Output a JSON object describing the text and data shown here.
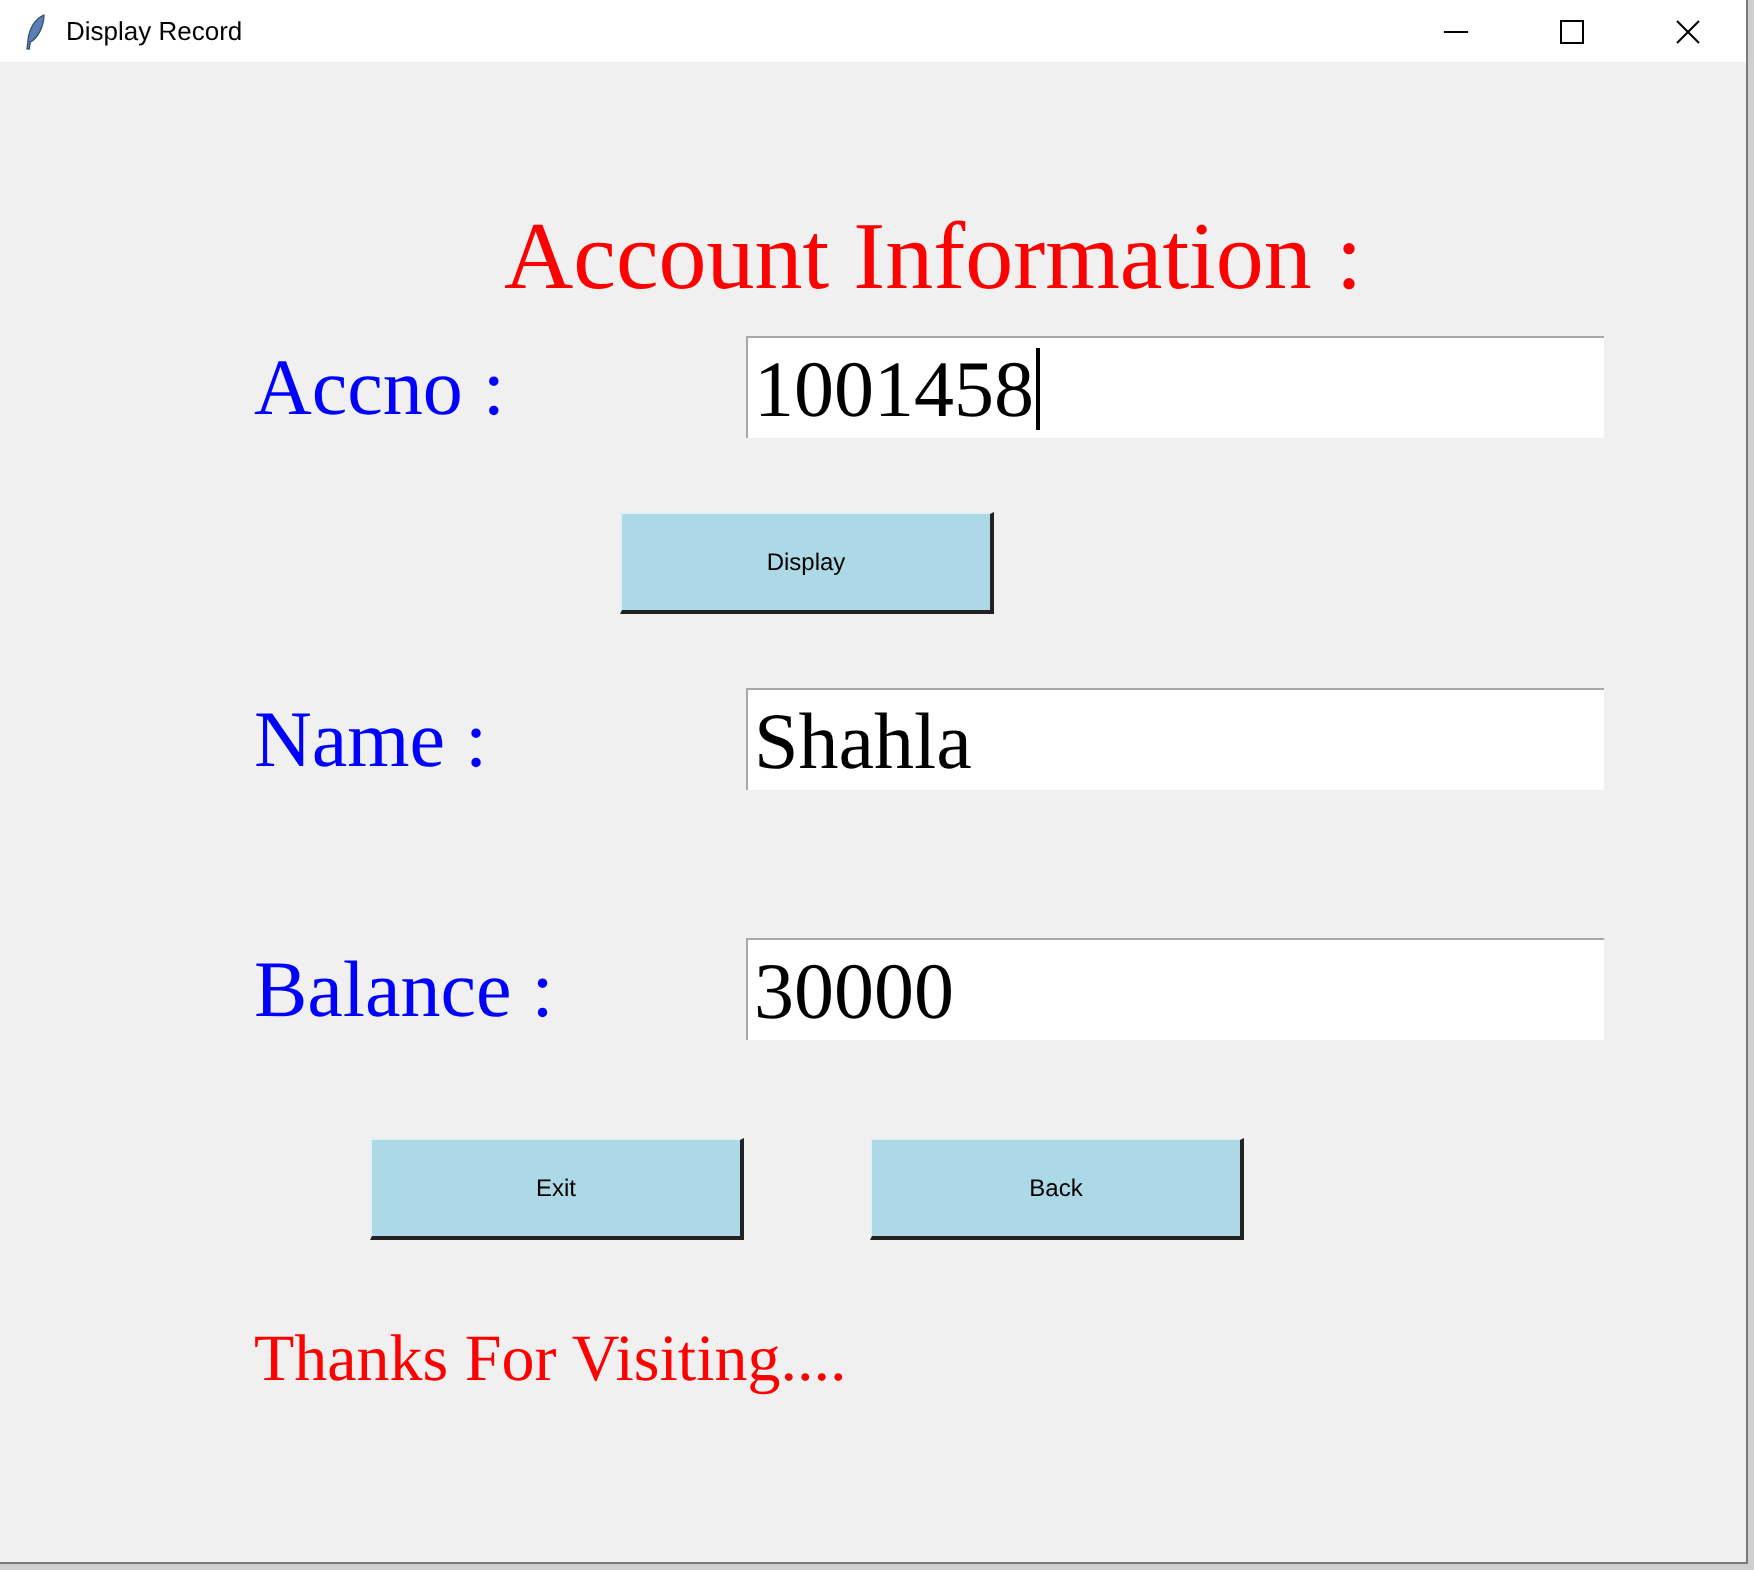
{
  "window": {
    "title": "Display Record"
  },
  "heading": "Account Information :",
  "rows": [
    {
      "kind": "field",
      "label": "Accno :",
      "value": "1001458",
      "focused": true
    },
    {
      "kind": "buttons",
      "buttons": [
        "Display"
      ]
    },
    {
      "kind": "field",
      "label": "Name :",
      "value": "Shahla",
      "focused": false
    },
    {
      "kind": "field",
      "label": "Balance :",
      "value": "30000",
      "focused": false
    },
    {
      "kind": "buttons",
      "buttons": [
        "Exit",
        "Back"
      ]
    }
  ],
  "message": "Thanks For Visiting...."
}
